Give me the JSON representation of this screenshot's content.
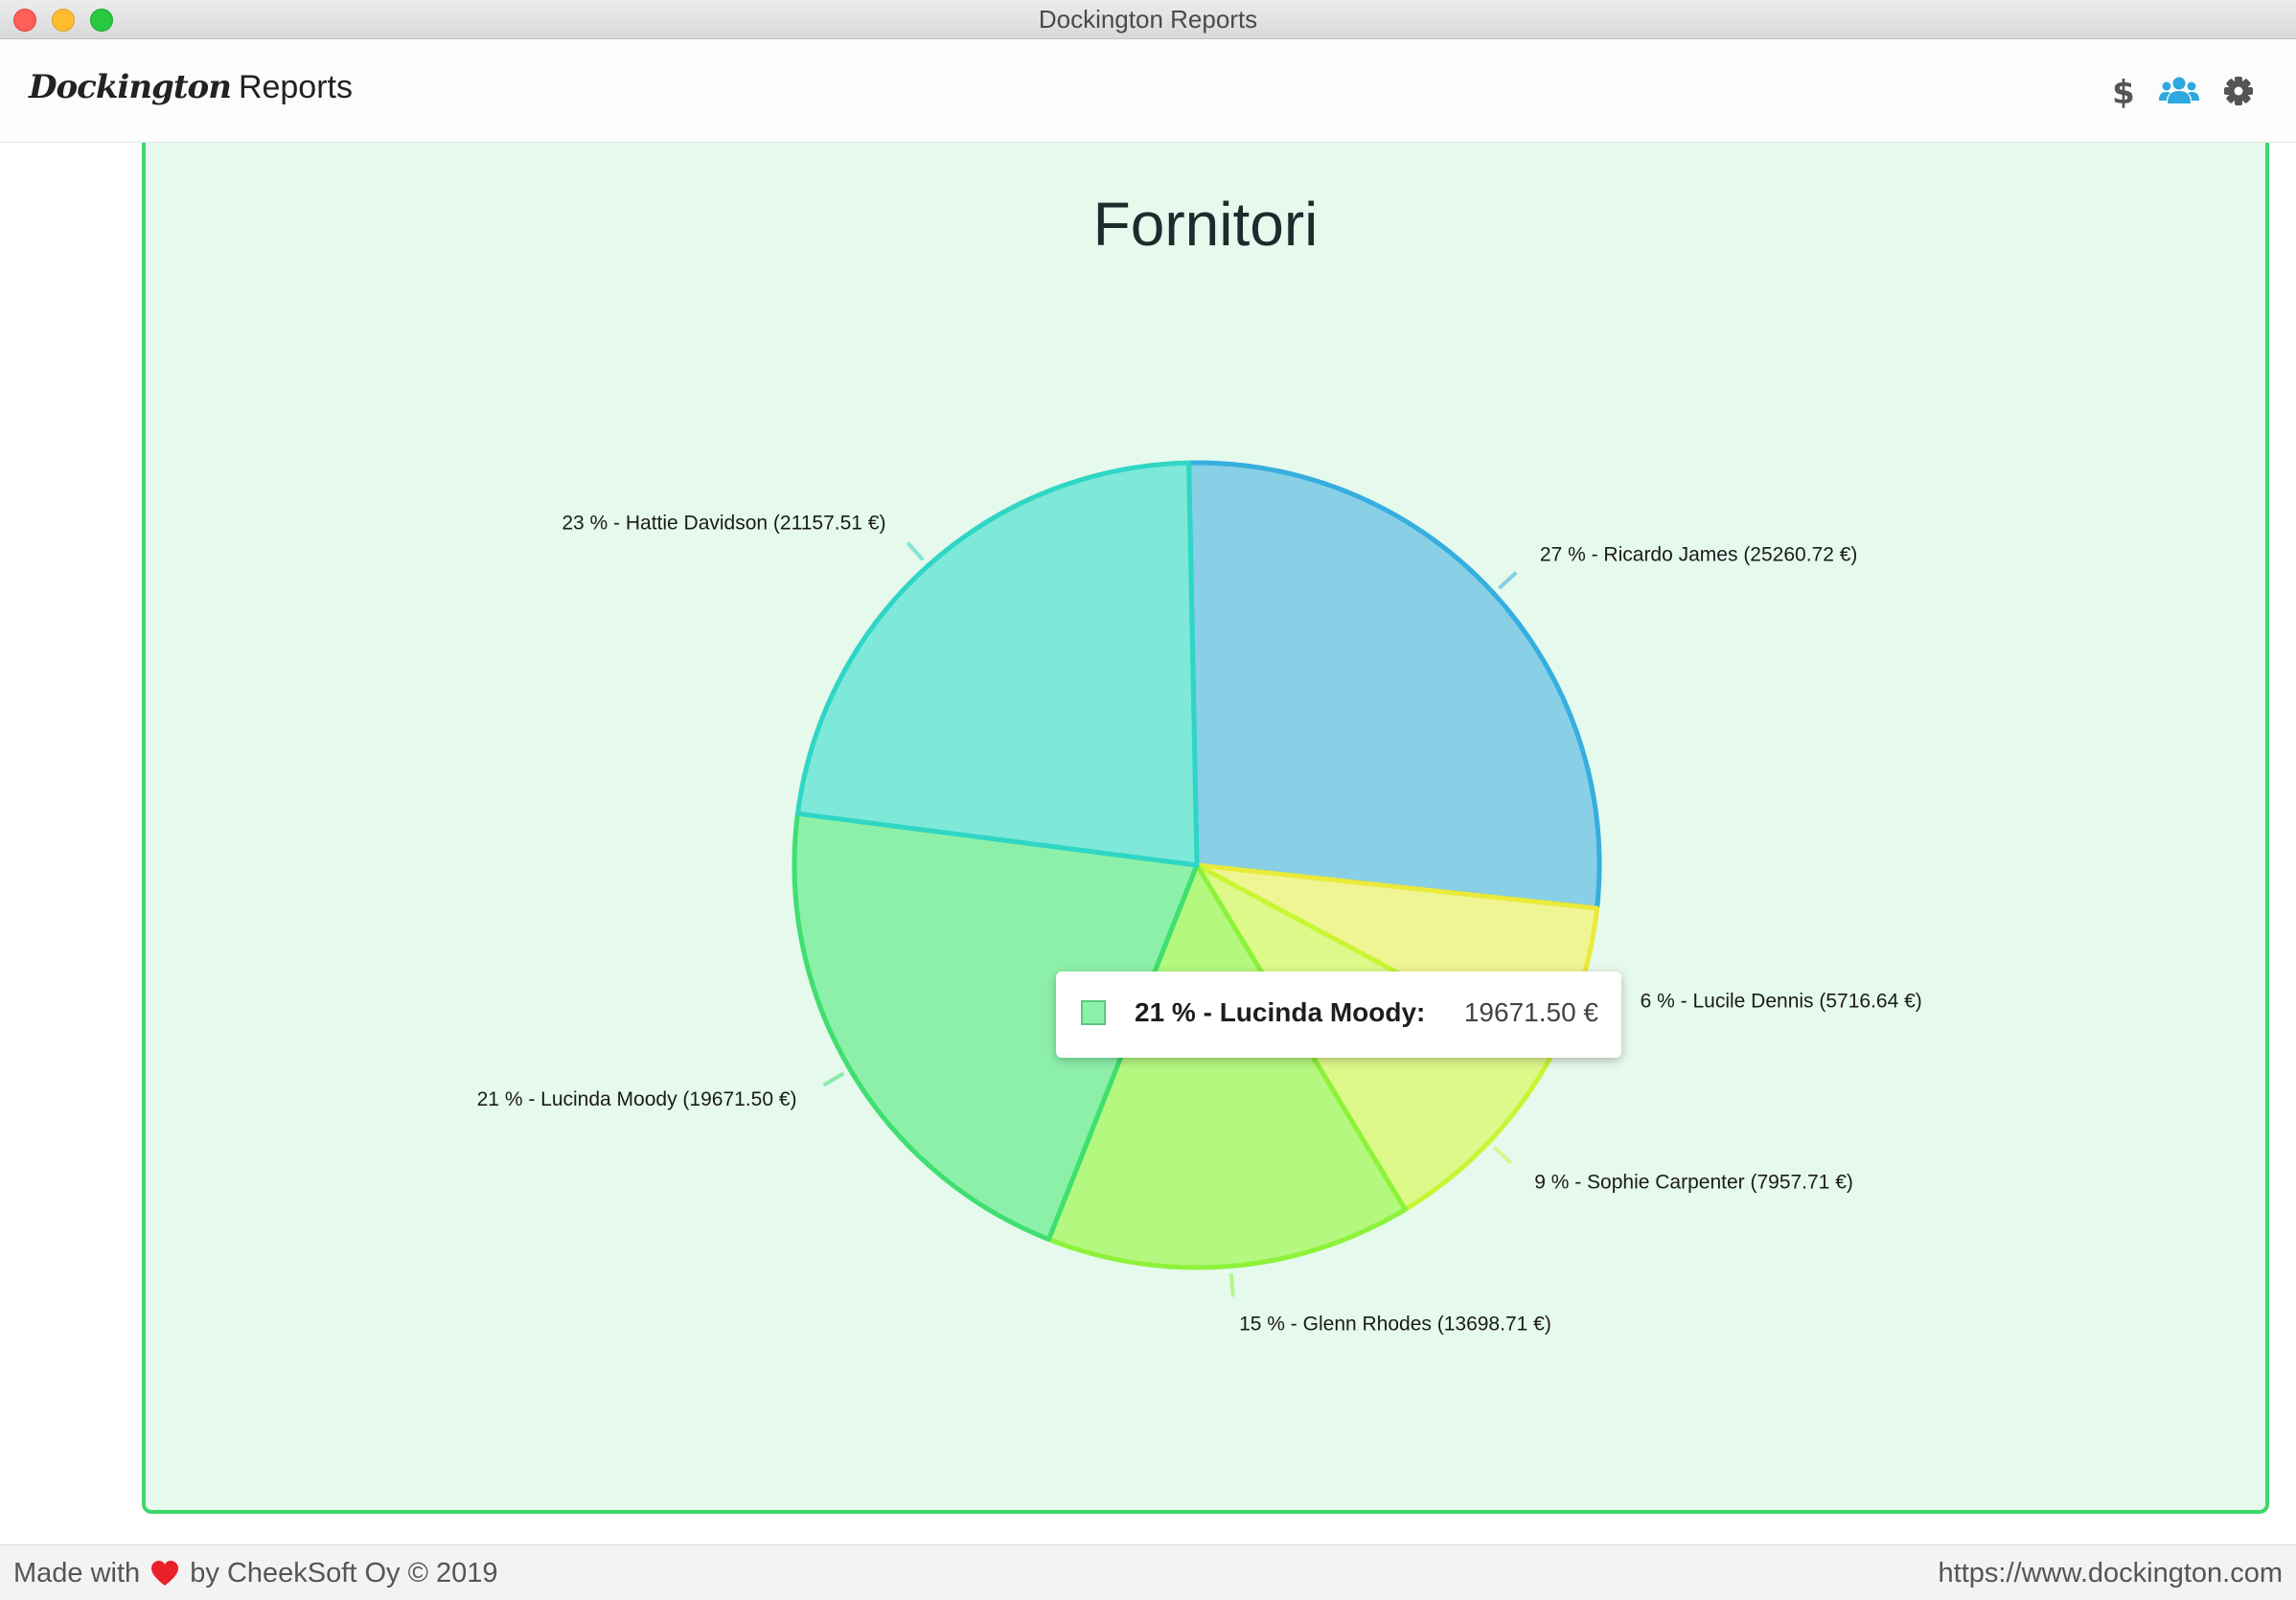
{
  "window": {
    "title": "Dockington Reports"
  },
  "header": {
    "brand_logo": "Dockington",
    "brand_text": "Reports",
    "icons": [
      "dollar-icon",
      "users-icon",
      "gear-icon"
    ],
    "active_color": "#2fa8e0",
    "icon_color": "#555555"
  },
  "chart_data": {
    "type": "pie",
    "title": "Fornitori",
    "slices": [
      {
        "label": "27 % - Ricardo James (25260.72 €)",
        "name": "Ricardo James",
        "percent": 27,
        "value": 25260.72,
        "fill": "#89cfe5",
        "stroke": "#36aee0"
      },
      {
        "label": "6 % - Lucile Dennis (5716.64 €)",
        "name": "Lucile Dennis",
        "percent": 6,
        "value": 5716.64,
        "fill": "#eff593",
        "stroke": "#eaea3a"
      },
      {
        "label": "9 % - Sophie Carpenter (7957.71 €)",
        "name": "Sophie Carpenter",
        "percent": 9,
        "value": 7957.71,
        "fill": "#ddf98a",
        "stroke": "#c9f535"
      },
      {
        "label": "15 % - Glenn Rhodes (13698.71 €)",
        "name": "Glenn Rhodes",
        "percent": 15,
        "value": 13698.71,
        "fill": "#b5f87f",
        "stroke": "#8df23a"
      },
      {
        "label": "21 % - Lucinda Moody (19671.50 €)",
        "name": "Lucinda Moody",
        "percent": 21,
        "value": 19671.5,
        "fill": "#8df0a9",
        "stroke": "#3fdf70"
      },
      {
        "label": "23 % - Hattie Davidson (21157.51 €)",
        "name": "Hattie Davidson",
        "percent": 23,
        "value": 21157.51,
        "fill": "#7ee8d9",
        "stroke": "#2fd6c6"
      }
    ],
    "tooltip": {
      "label": "21 % - Lucinda Moody:",
      "value": "19671.50 €",
      "slice": "Lucinda Moody"
    }
  },
  "footer": {
    "left_prefix": "Made with",
    "left_suffix": "by CheekSoft Oy © 2019",
    "right": "https://www.dockington.com"
  }
}
